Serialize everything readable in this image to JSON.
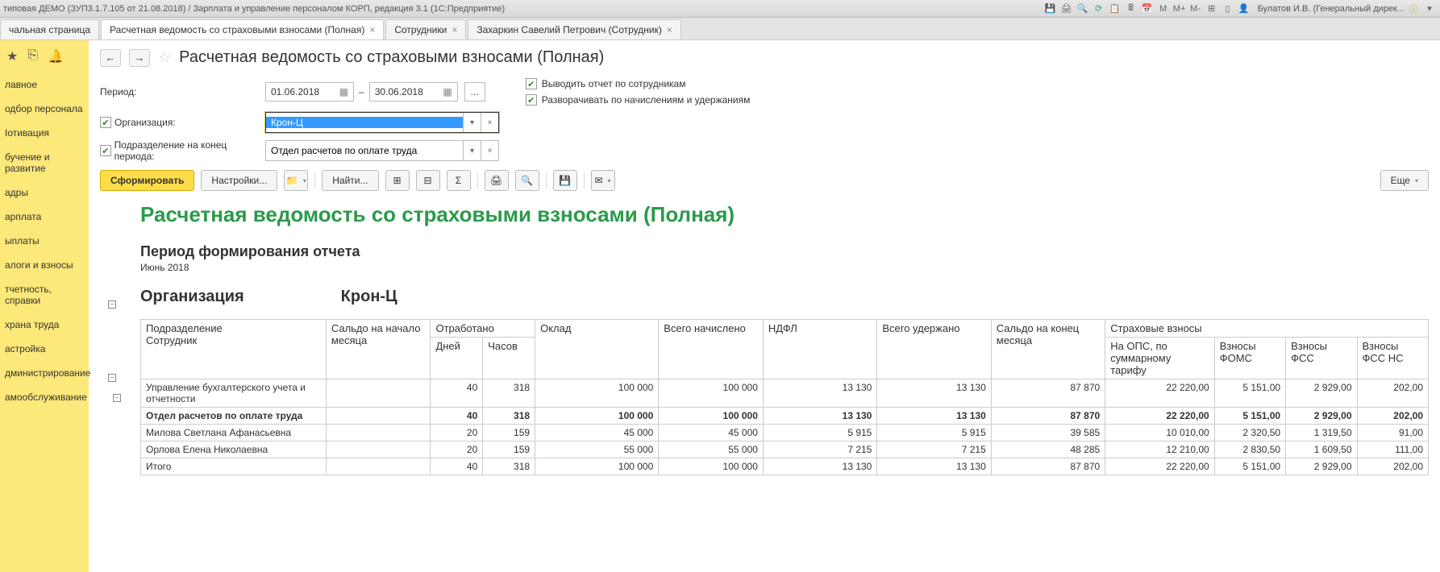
{
  "titlebar": {
    "title": "типовая ДЕМО (ЗУП3.1.7.105 от 21.08.2018) / Зарплата и управление персоналом КОРП, редакция 3.1  (1С:Предприятие)",
    "user": "Булатов И.В. (Генеральный дирек..."
  },
  "tabs": [
    {
      "label": "чальная страница",
      "closable": false
    },
    {
      "label": "Расчетная ведомость со страховыми взносами (Полная)",
      "closable": true,
      "active": true
    },
    {
      "label": "Сотрудники",
      "closable": true
    },
    {
      "label": "Захаркин Савелий Петрович (Сотрудник)",
      "closable": true
    }
  ],
  "sidebar": {
    "items": [
      "лавное",
      "одбор персонала",
      "Іотивация",
      "бучение и развитие",
      "адры",
      "арплата",
      "ыплаты",
      "алоги и взносы",
      "тчетность, справки",
      "храна труда",
      "астройка",
      "дминистрирование",
      "амообслуживание"
    ]
  },
  "header": {
    "title": "Расчетная ведомость со страховыми взносами (Полная)"
  },
  "filters": {
    "period_label": "Период:",
    "date_from": "01.06.2018",
    "date_to": "30.06.2018",
    "org_label": "Организация:",
    "org_value": "Крон-Ц",
    "dept_label": "Подразделение на конец периода:",
    "dept_value": "Отдел расчетов по оплате труда",
    "chk1": "Выводить отчет по сотрудникам",
    "chk2": "Разворачивать по начислениям и удержаниям"
  },
  "toolbar": {
    "form": "Сформировать",
    "settings": "Настройки...",
    "find": "Найти...",
    "more": "Еще"
  },
  "report": {
    "title": "Расчетная ведомость со страховыми взносами (Полная)",
    "period_title": "Период формирования отчета",
    "period_sub": "Июнь 2018",
    "org_label": "Организация",
    "org_value": "Крон-Ц",
    "headers": {
      "dept": "Подразделение",
      "emp": "Сотрудник",
      "saldo_start": "Сальдо на начало месяца",
      "worked": "Отработано",
      "days": "Дней",
      "hours": "Часов",
      "salary": "Оклад",
      "total_acc": "Всего начислено",
      "ndfl": "НДФЛ",
      "total_wh": "Всего удержано",
      "saldo_end": "Сальдо на конец месяца",
      "ins": "Страховые взносы",
      "ops": "На ОПС, по суммарному тарифу",
      "foms": "Взносы ФОМС",
      "fss": "Взносы ФСС",
      "fss_ns": "Взносы ФСС НС"
    },
    "rows": [
      {
        "name": "Управление бухгалтерского учета и отчетности",
        "days": "40",
        "hours": "318",
        "salary": "100 000",
        "acc": "100 000",
        "ndfl": "13 130",
        "wh": "13 130",
        "end": "87 870",
        "ops": "22 220,00",
        "foms": "5 151,00",
        "fss": "2 929,00",
        "fssns": "202,00"
      },
      {
        "name": "Отдел расчетов по оплате труда",
        "days": "40",
        "hours": "318",
        "salary": "100 000",
        "acc": "100 000",
        "ndfl": "13 130",
        "wh": "13 130",
        "end": "87 870",
        "ops": "22 220,00",
        "foms": "5 151,00",
        "fss": "2 929,00",
        "fssns": "202,00",
        "bold": true
      },
      {
        "name": "Милова Светлана Афанасьевна",
        "days": "20",
        "hours": "159",
        "salary": "45 000",
        "acc": "45 000",
        "ndfl": "5 915",
        "wh": "5 915",
        "end": "39 585",
        "ops": "10 010,00",
        "foms": "2 320,50",
        "fss": "1 319,50",
        "fssns": "91,00"
      },
      {
        "name": "Орлова Елена Николаевна",
        "days": "20",
        "hours": "159",
        "salary": "55 000",
        "acc": "55 000",
        "ndfl": "7 215",
        "wh": "7 215",
        "end": "48 285",
        "ops": "12 210,00",
        "foms": "2 830,50",
        "fss": "1 609,50",
        "fssns": "111,00"
      },
      {
        "name": "Итого",
        "days": "40",
        "hours": "318",
        "salary": "100 000",
        "acc": "100 000",
        "ndfl": "13 130",
        "wh": "13 130",
        "end": "87 870",
        "ops": "22 220,00",
        "foms": "5 151,00",
        "fss": "2 929,00",
        "fssns": "202,00"
      }
    ]
  }
}
